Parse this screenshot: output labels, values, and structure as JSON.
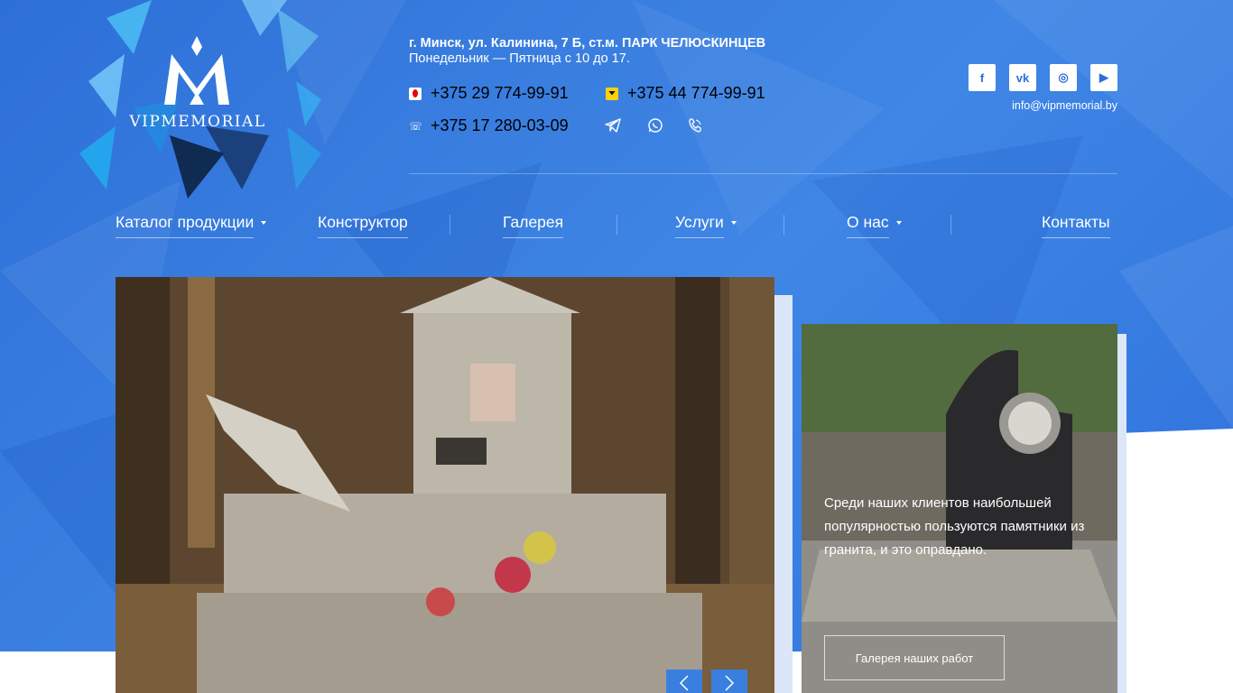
{
  "brand": {
    "name": "VIPMEMORIAL"
  },
  "contacts": {
    "address": "г. Минск, ул. Калинина, 7 Б, ст.м. ПАРК ЧЕЛЮСКИНЦЕВ",
    "hours": "Понедельник — Пятница с 10 до 17.",
    "phones": [
      {
        "operator_icon": "mts-icon",
        "number": "+375 29 774-99-91"
      },
      {
        "operator_icon": "a1-icon",
        "number": "+375 44 774-99-91"
      },
      {
        "operator_icon": "city-phone-icon",
        "number": "+375 17 280-03-09"
      }
    ],
    "messengers": [
      "telegram-icon",
      "whatsapp-icon",
      "viber-icon"
    ],
    "email": "info@vipmemorial.by"
  },
  "socials": [
    {
      "icon": "facebook-icon",
      "glyph": "f"
    },
    {
      "icon": "vk-icon",
      "glyph": "vk"
    },
    {
      "icon": "instagram-icon",
      "glyph": "◎"
    },
    {
      "icon": "youtube-icon",
      "glyph": "▶"
    }
  ],
  "nav": [
    {
      "label": "Каталог продукции",
      "dropdown": true
    },
    {
      "label": "Конструктор",
      "dropdown": false
    },
    {
      "label": "Галерея",
      "dropdown": false
    },
    {
      "label": "Услуги",
      "dropdown": true
    },
    {
      "label": "О нас",
      "dropdown": true
    },
    {
      "label": "Контакты",
      "dropdown": false
    }
  ],
  "slider": {
    "prev_icon": "chevron-left-icon",
    "next_icon": "chevron-right-icon"
  },
  "card": {
    "text": "Среди наших клиентов наибольшей популярностью пользуются памятники из гранита, и это оправдано.",
    "button_label": "Галерея наших работ"
  },
  "colors": {
    "accent": "#3a7fe0",
    "hero_blue": "#2f72dc",
    "text_light": "#ffffff"
  }
}
